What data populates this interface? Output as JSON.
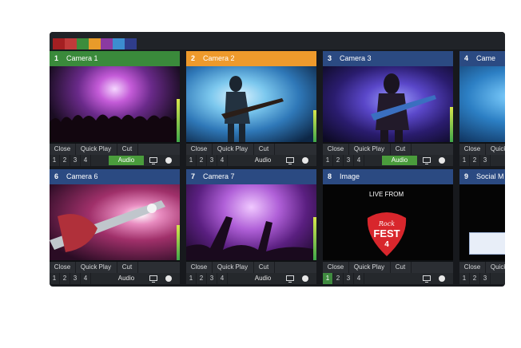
{
  "colors": {
    "swatches": [
      "#a41f22",
      "#c03a3a",
      "#3c8d3c",
      "#e89b2a",
      "#8b3aa1",
      "#3c8dcf",
      "#2f3d8a"
    ],
    "header_green": "#3a8a3b",
    "header_orange": "#ee9a2c",
    "header_blue": "#2b4a82",
    "audio_on": "#4a9c3c"
  },
  "controls": {
    "close": "Close",
    "quick_play": "Quick Play",
    "cut": "Cut",
    "audio": "Audio",
    "overlay_numbers": [
      "1",
      "2",
      "3",
      "4"
    ]
  },
  "inputs": [
    {
      "number": "1",
      "title": "Camera 1",
      "status": "program"
    },
    {
      "number": "2",
      "title": "Camera 2",
      "status": "preview"
    },
    {
      "number": "3",
      "title": "Camera 3",
      "status": "idle"
    },
    {
      "number": "4",
      "title": "Came",
      "status": "idle"
    },
    {
      "number": "6",
      "title": "Camera 6",
      "status": "idle"
    },
    {
      "number": "7",
      "title": "Camera 7",
      "status": "idle"
    },
    {
      "number": "8",
      "title": "Image",
      "status": "idle"
    },
    {
      "number": "9",
      "title": "Social M",
      "status": "idle"
    }
  ],
  "image_input": {
    "caption": "LIVE FROM",
    "logo_lines": [
      "Rock",
      "FEST",
      "4"
    ]
  },
  "icons": [
    "monitor-icon",
    "record-dot-icon",
    "guitar-pick-logo"
  ]
}
